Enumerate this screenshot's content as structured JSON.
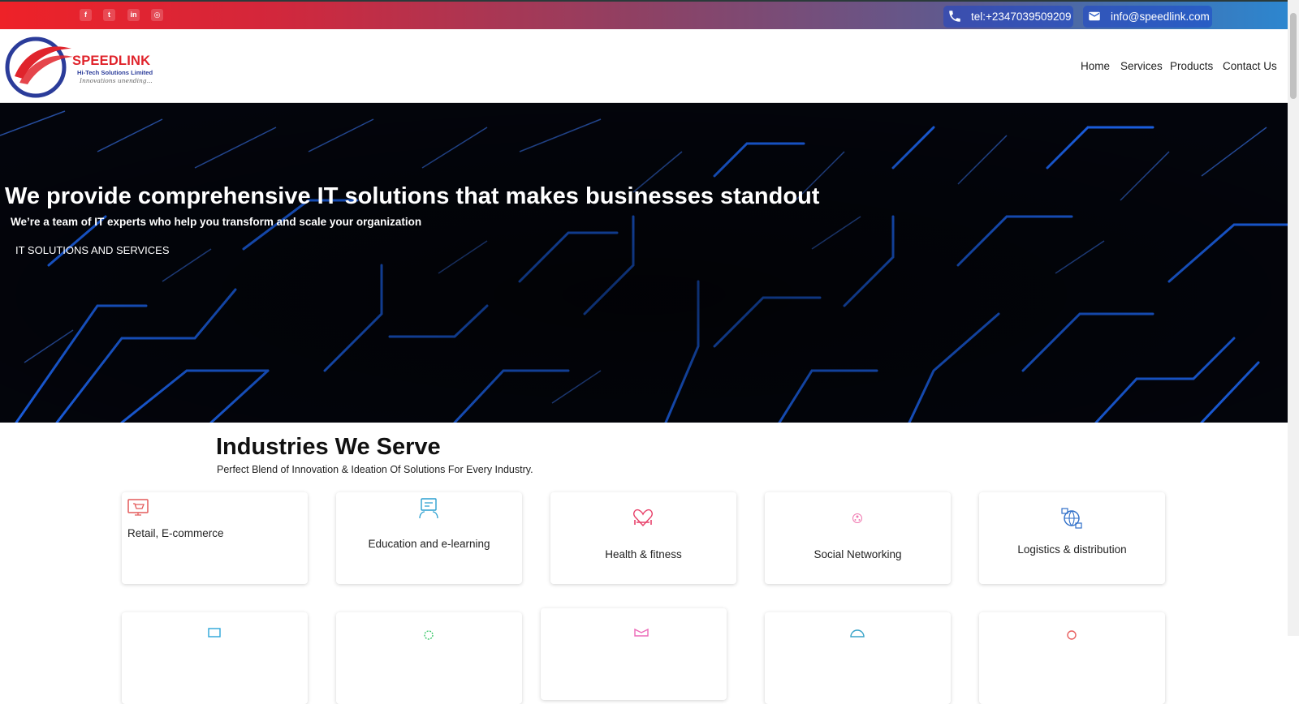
{
  "topbar": {
    "social": [
      {
        "icon": "facebook-icon",
        "glyph": "f"
      },
      {
        "icon": "twitter-icon",
        "glyph": "t"
      },
      {
        "icon": "linkedin-icon",
        "glyph": "in"
      },
      {
        "icon": "instagram-icon",
        "glyph": "◎"
      }
    ],
    "phone": "tel:+2347039509209",
    "email": "info@speedlink.com"
  },
  "logo": {
    "name": "SPEEDLINK",
    "subtitle": "Hi-Tech Solutions Limited",
    "tagline": "Innovations unending..."
  },
  "nav": [
    "Home",
    "Services",
    "Products",
    "Contact Us"
  ],
  "hero": {
    "title": "We provide comprehensive IT solutions that makes businesses standout",
    "subtitle": "We’re a team of IT experts who help you transform and scale your organization",
    "button": "IT SOLUTIONS AND SERVICES"
  },
  "industries": {
    "title": "Industries We Serve",
    "subtitle": "Perfect Blend of Innovation & Ideation Of Solutions For Every Industry.",
    "cards": [
      {
        "label": "Retail, E-commerce",
        "icon": "shopping-cart-icon"
      },
      {
        "label": "Education and e-learning",
        "icon": "e-learning-icon"
      },
      {
        "label": "Health & fitness",
        "icon": "heart-dumbbell-icon"
      },
      {
        "label": "Social Networking",
        "icon": "social-network-icon"
      },
      {
        "label": "Logistics & distribution",
        "icon": "logistics-globe-icon"
      }
    ]
  },
  "colors": {
    "brand_red": "#e0242c",
    "brand_blue": "#2b3c9a",
    "hero_bg": "#03050c",
    "circuit_blue": "#1e6bff"
  }
}
